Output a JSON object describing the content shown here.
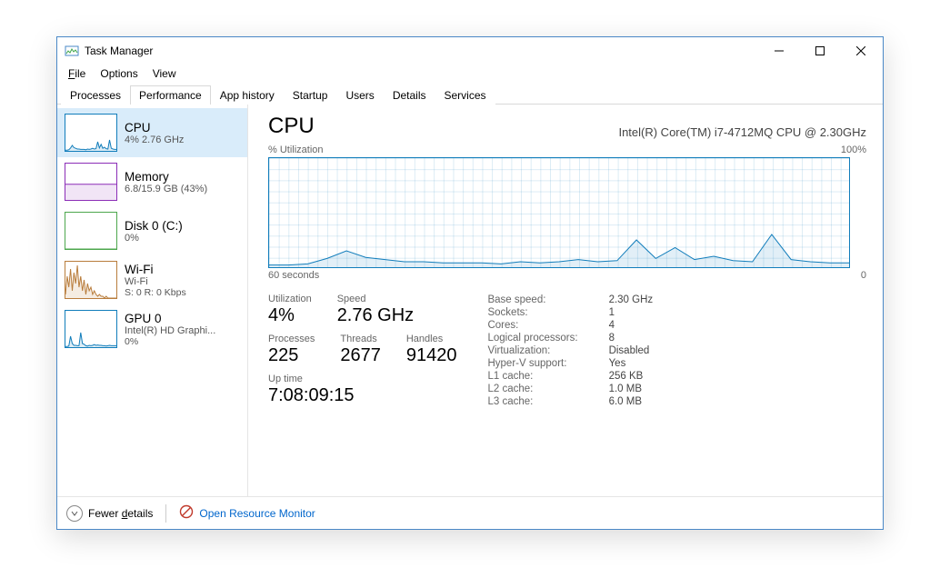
{
  "window": {
    "title": "Task Manager"
  },
  "menu": {
    "file": "File",
    "options": "Options",
    "view": "View"
  },
  "tabs": [
    "Processes",
    "Performance",
    "App history",
    "Startup",
    "Users",
    "Details",
    "Services"
  ],
  "active_tab": "Performance",
  "sidebar": [
    {
      "title": "CPU",
      "sub": "4%  2.76 GHz",
      "color": "#117dbb",
      "selected": true,
      "thumb": "cpu"
    },
    {
      "title": "Memory",
      "sub": "6.8/15.9 GB (43%)",
      "color": "#8b2db7",
      "thumb": "memory"
    },
    {
      "title": "Disk 0 (C:)",
      "sub": "0%",
      "color": "#4ca64c",
      "thumb": "disk"
    },
    {
      "title": "Wi-Fi",
      "sub": "Wi-Fi",
      "sub2": "S: 0  R: 0 Kbps",
      "color": "#b97d3c",
      "thumb": "wifi"
    },
    {
      "title": "GPU 0",
      "sub": "Intel(R) HD Graphi...",
      "sub2": "0%",
      "color": "#117dbb",
      "thumb": "gpu"
    }
  ],
  "main": {
    "title": "CPU",
    "subtitle": "Intel(R) Core(TM) i7-4712MQ CPU @ 2.30GHz",
    "util_label": "% Utilization",
    "util_max": "100%",
    "axis_left": "60 seconds",
    "axis_right": "0"
  },
  "stats": {
    "utilization_label": "Utilization",
    "utilization_value": "4%",
    "speed_label": "Speed",
    "speed_value": "2.76 GHz",
    "processes_label": "Processes",
    "processes_value": "225",
    "threads_label": "Threads",
    "threads_value": "2677",
    "handles_label": "Handles",
    "handles_value": "91420",
    "uptime_label": "Up time",
    "uptime_value": "7:08:09:15"
  },
  "details": [
    [
      "Base speed:",
      "2.30 GHz"
    ],
    [
      "Sockets:",
      "1"
    ],
    [
      "Cores:",
      "4"
    ],
    [
      "Logical processors:",
      "8"
    ],
    [
      "Virtualization:",
      "Disabled"
    ],
    [
      "Hyper-V support:",
      "Yes"
    ],
    [
      "L1 cache:",
      "256 KB"
    ],
    [
      "L2 cache:",
      "1.0 MB"
    ],
    [
      "L3 cache:",
      "6.0 MB"
    ]
  ],
  "footer": {
    "fewer_details": "Fewer details",
    "resource_monitor": "Open Resource Monitor"
  },
  "chart_data": {
    "type": "area",
    "title": "CPU % Utilization",
    "xlabel": "seconds",
    "ylabel": "% Utilization",
    "ylim": [
      0,
      100
    ],
    "xlim": [
      60,
      0
    ],
    "x": [
      60,
      58,
      56,
      54,
      52,
      50,
      48,
      46,
      44,
      42,
      40,
      38,
      36,
      34,
      32,
      30,
      28,
      26,
      24,
      22,
      20,
      18,
      16,
      14,
      12,
      10,
      8,
      6,
      4,
      2,
      0
    ],
    "values": [
      2,
      2,
      3,
      8,
      15,
      9,
      7,
      5,
      5,
      4,
      4,
      4,
      3,
      5,
      4,
      5,
      7,
      5,
      6,
      25,
      8,
      18,
      7,
      10,
      6,
      5,
      30,
      7,
      5,
      4,
      4
    ]
  },
  "thumb_charts": {
    "cpu": [
      2,
      2,
      3,
      8,
      15,
      9,
      7,
      5,
      5,
      4,
      4,
      4,
      3,
      5,
      4,
      5,
      7,
      5,
      6,
      25,
      8,
      18,
      7,
      10,
      6,
      5,
      30,
      7,
      5,
      4,
      4
    ],
    "memory": 43,
    "disk": [
      0,
      0,
      0,
      0,
      0,
      0,
      0,
      0,
      0,
      0,
      0,
      0,
      0,
      0,
      0,
      0,
      0,
      0,
      0,
      0,
      0,
      0,
      0,
      0,
      0,
      0,
      0,
      0,
      0,
      0,
      0
    ],
    "wifi": [
      10,
      60,
      30,
      80,
      20,
      70,
      40,
      90,
      30,
      60,
      20,
      50,
      10,
      40,
      20,
      30,
      10,
      20,
      10,
      5,
      10,
      5,
      5,
      0,
      5,
      0,
      0,
      0,
      0,
      0,
      0
    ],
    "gpu": [
      2,
      2,
      3,
      30,
      10,
      5,
      5,
      4,
      4,
      40,
      10,
      8,
      4,
      3,
      5,
      4,
      5,
      7,
      5,
      6,
      5,
      5,
      4,
      4,
      3,
      4,
      5,
      4,
      4,
      4,
      4
    ]
  }
}
